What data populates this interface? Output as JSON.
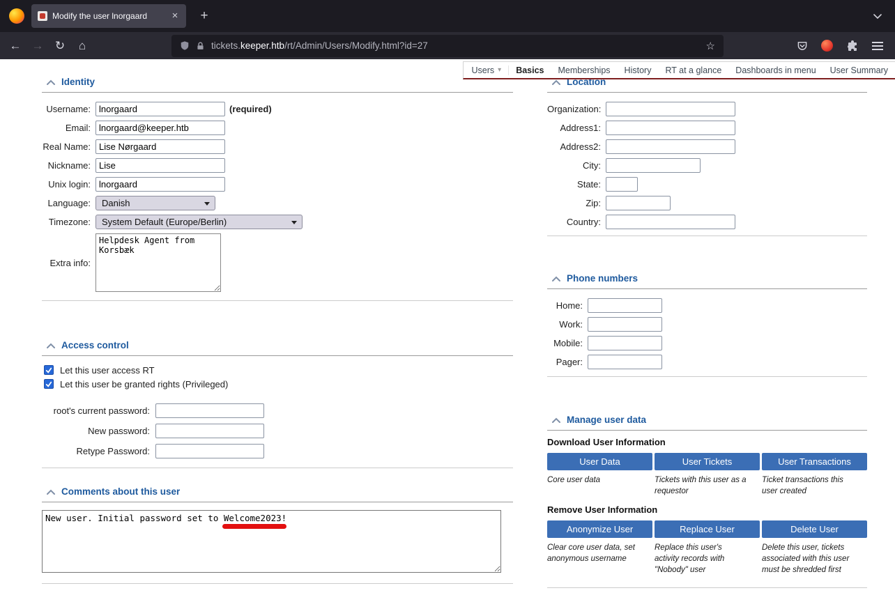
{
  "browser": {
    "tab_title": "Modify the user lnorgaard",
    "url_subdomain": "tickets.",
    "url_domain": "keeper.htb",
    "url_path": "/rt/Admin/Users/Modify.html?id=27"
  },
  "glyphs": {
    "back": "←",
    "forward": "→",
    "reload": "↻",
    "home": "⌂",
    "new_tab": "+",
    "close_tab": "×",
    "star": "☆",
    "users_arrow": "▾"
  },
  "page_menu": {
    "users_label": "Users",
    "items": [
      "Basics",
      "Memberships",
      "History",
      "RT at a glance",
      "Dashboards in menu",
      "User Summary"
    ]
  },
  "identity": {
    "title": "Identity",
    "username": {
      "label": "Username:",
      "value": "lnorgaard",
      "required_note": "(required)"
    },
    "email": {
      "label": "Email:",
      "value": "lnorgaard@keeper.htb"
    },
    "real_name": {
      "label": "Real Name:",
      "value": "Lise Nørgaard"
    },
    "nickname": {
      "label": "Nickname:",
      "value": "Lise"
    },
    "unix_login": {
      "label": "Unix login:",
      "value": "lnorgaard"
    },
    "language": {
      "label": "Language:",
      "value": "Danish"
    },
    "timezone": {
      "label": "Timezone:",
      "value": "System Default (Europe/Berlin)"
    },
    "extra_info": {
      "label": "Extra info:",
      "value": "Helpdesk Agent from\nKorsbæk"
    }
  },
  "access_control": {
    "title": "Access control",
    "checkbox_access_rt": "Let this user access RT",
    "checkbox_privileged": "Let this user be granted rights (Privileged)",
    "current_password_label": "root's current password:",
    "new_password_label": "New password:",
    "retype_password_label": "Retype Password:"
  },
  "comments": {
    "title": "Comments about this user",
    "value": "New user. Initial password set to Welcome2023!"
  },
  "location": {
    "title": "Location",
    "organization_label": "Organization:",
    "address1_label": "Address1:",
    "address2_label": "Address2:",
    "city_label": "City:",
    "state_label": "State:",
    "zip_label": "Zip:",
    "country_label": "Country:"
  },
  "phones": {
    "title": "Phone numbers",
    "home_label": "Home:",
    "work_label": "Work:",
    "mobile_label": "Mobile:",
    "pager_label": "Pager:"
  },
  "manage": {
    "title": "Manage user data",
    "download_heading": "Download User Information",
    "download": [
      {
        "label": "User Data",
        "desc": "Core user data"
      },
      {
        "label": "User Tickets",
        "desc": "Tickets with this user as a requestor"
      },
      {
        "label": "User Transactions",
        "desc": "Ticket transactions this user created"
      }
    ],
    "remove_heading": "Remove User Information",
    "remove": [
      {
        "label": "Anonymize User",
        "desc": "Clear core user data, set anonymous username"
      },
      {
        "label": "Replace User",
        "desc": "Replace this user's activity records with \"Nobody\" user"
      },
      {
        "label": "Delete User",
        "desc": "Delete this user, tickets associated with this user must be shredded first"
      }
    ]
  },
  "colors": {
    "rt_header_blue": "#1e5a9e",
    "button_blue": "#3b6eb5",
    "annotation_red": "#e31010",
    "menu_accent_maroon": "#7e1e1e"
  }
}
